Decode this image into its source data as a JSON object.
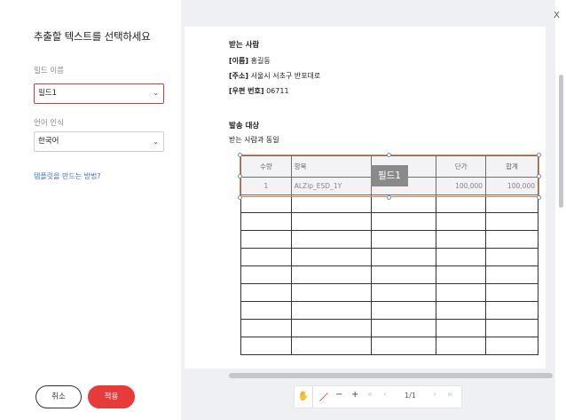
{
  "left_panel": {
    "title": "추출할 텍스트를 선택하세요",
    "field_name_label": "필드 이름",
    "field_name_value": "필드1",
    "language_label": "언어 인식",
    "language_value": "한국어",
    "help_link": "템플릿을 만드는 방법?",
    "cancel_label": "취소",
    "apply_label": "적용"
  },
  "document": {
    "recipient_heading": "받는 사람",
    "name_label": "[이름]",
    "name_value": "홍길동",
    "address_label": "[주소]",
    "address_value": "서울시 서초구 반포대로",
    "postal_label": "[우편 번호]",
    "postal_value": "06711",
    "shipping_heading": "발송 대상",
    "shipping_value": "받는 사람과 동일",
    "table_headers": [
      "수량",
      "항목",
      "",
      "단가",
      "합계"
    ],
    "table_row": [
      "1",
      "ALZip_ESD_1Y",
      "",
      "100,000",
      "100,000"
    ],
    "field_tag": "필드1"
  },
  "toolbar": {
    "hand_icon": "✋",
    "pen_icon": "／",
    "zoom_out": "−",
    "zoom_in": "+",
    "first_page": "«",
    "prev_page": "‹",
    "page_indicator": "1/1",
    "next_page": "›",
    "last_page": "»"
  },
  "window": {
    "close_label": "X"
  },
  "colors": {
    "accent": "#e73b3b",
    "selection": "#e0833c",
    "link": "#3d6fd6"
  }
}
